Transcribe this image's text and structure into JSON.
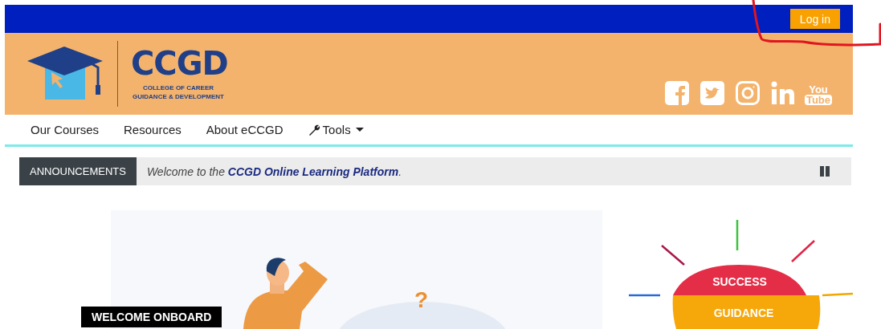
{
  "top_bar": {
    "login_button": "Log in"
  },
  "header": {
    "logo": {
      "title": "CCGD",
      "subtitle_lines": [
        "COLLEGE OF CAREER",
        "GUIDANCE & DEVELOPMENT"
      ]
    },
    "social_links": [
      {
        "kind": "facebook"
      },
      {
        "kind": "twitter"
      },
      {
        "kind": "instagram"
      },
      {
        "kind": "linkedin"
      },
      {
        "kind": "youtube",
        "label_lines": [
          "You",
          "Tube"
        ]
      }
    ]
  },
  "nav": {
    "items": [
      {
        "label": "Our Courses",
        "kind": "link"
      },
      {
        "label": "Resources",
        "kind": "link"
      },
      {
        "label": "About eCCGD",
        "kind": "link"
      },
      {
        "label": "Tools",
        "kind": "dropdown"
      }
    ]
  },
  "announcements": {
    "label": "ANNOUNCEMENTS",
    "message": "Welcome to the **CCGD Online Learning Platform**."
  },
  "hero": {
    "badge": "WELCOME ONBOARD",
    "question_mark": "?"
  },
  "success_graphic": {
    "top_label": "SUCCESS",
    "bottom_label": "GUIDANCE"
  }
}
